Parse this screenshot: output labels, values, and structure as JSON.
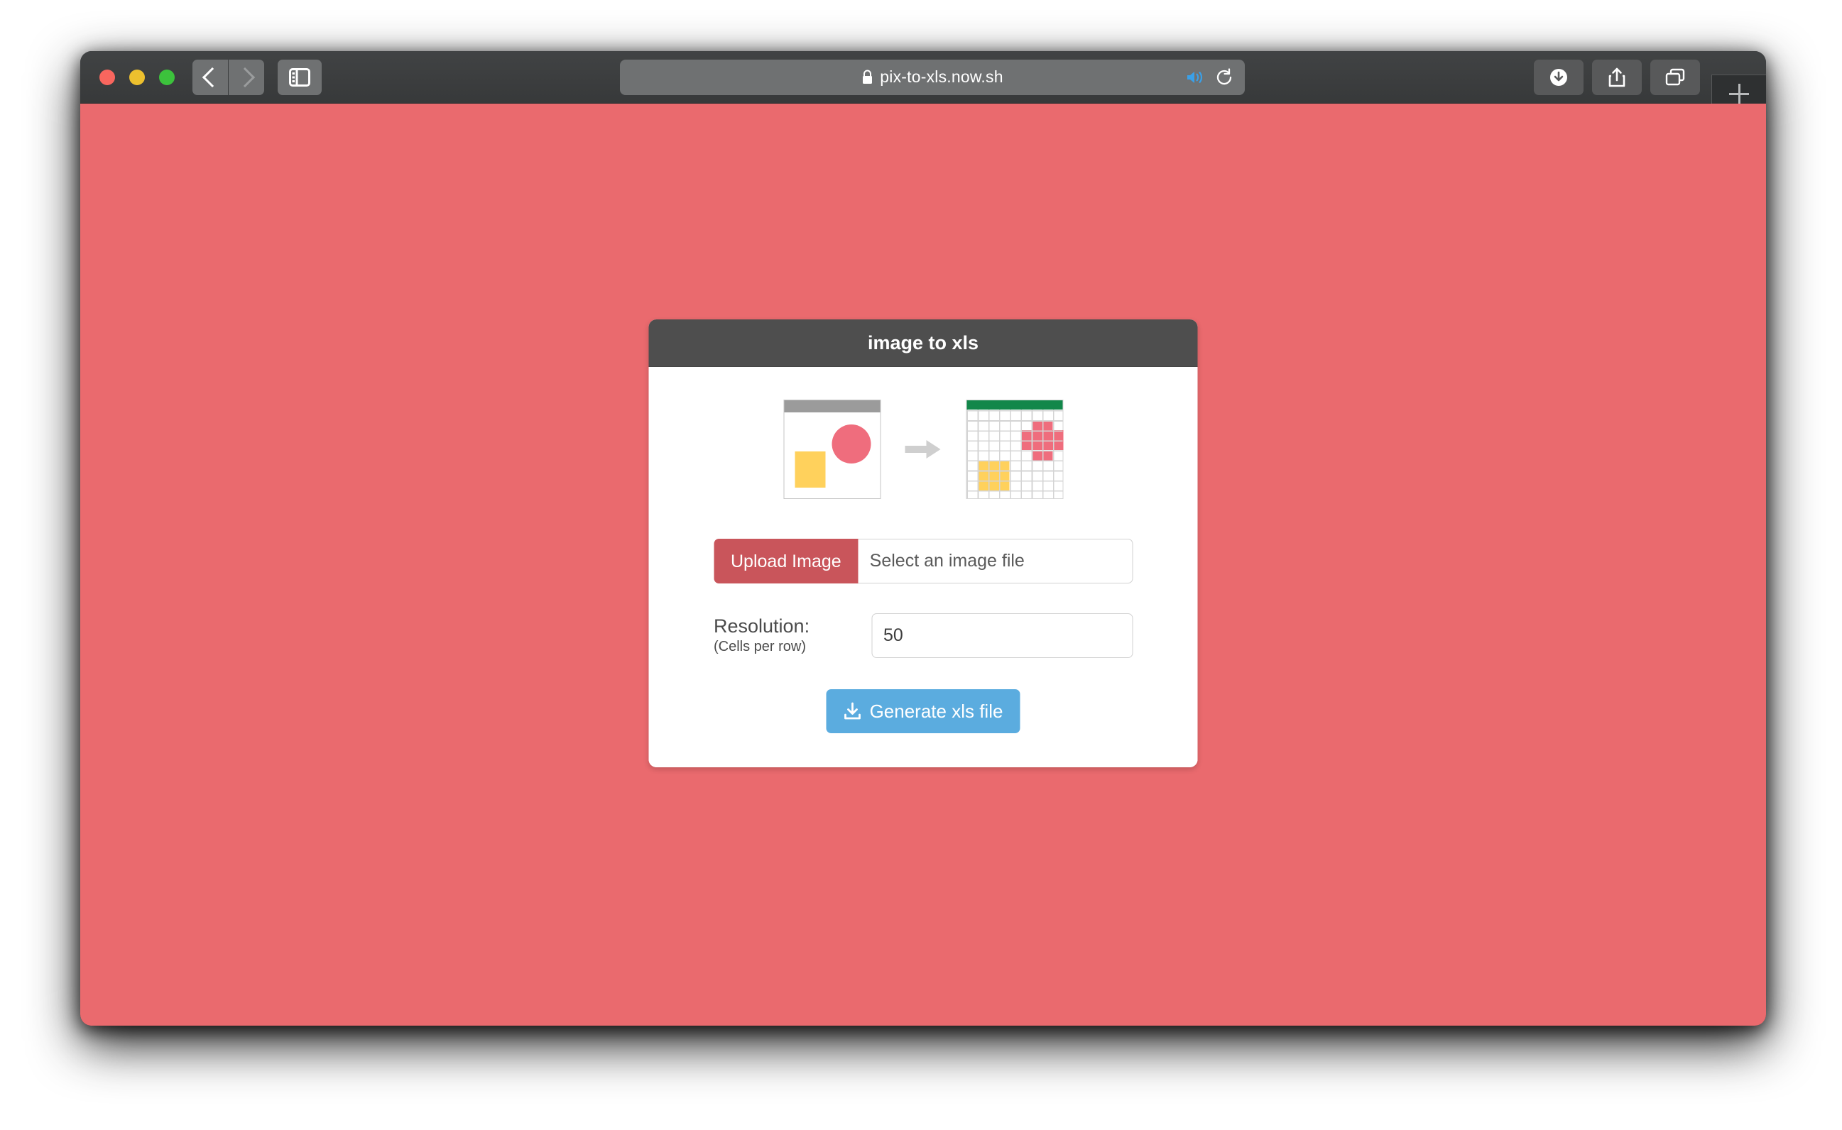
{
  "browser": {
    "url": "pix-to-xls.now.sh",
    "lock_icon": "lock-icon",
    "audio_icon": "speaker-icon",
    "reload_icon": "reload-icon",
    "back_icon": "chevron-left-icon",
    "forward_icon": "chevron-right-icon",
    "sidebar_icon": "sidebar-toggle-icon",
    "downloads_icon": "downloads-icon",
    "share_icon": "share-icon",
    "tabs_icon": "tab-overview-icon",
    "new_tab_icon": "plus-icon",
    "traffic_lights": [
      "close-button",
      "minimize-button",
      "zoom-button"
    ]
  },
  "page": {
    "background_color": "#ea6a6e",
    "card": {
      "title": "image to xls",
      "header_color": "#4e4e4e",
      "illustration": {
        "source_label": "source-image-preview",
        "arrow_label": "conversion-arrow",
        "result_label": "spreadsheet-grid-preview",
        "shape_pink": "#ef6d7d",
        "shape_yellow": "#ffd15c",
        "grid_header_color": "#12874a",
        "grid_columns": 9,
        "grid_rows": 10,
        "pink_cells": [
          [
            2,
            6
          ],
          [
            2,
            7
          ],
          [
            3,
            5
          ],
          [
            3,
            6
          ],
          [
            3,
            7
          ],
          [
            3,
            8
          ],
          [
            4,
            5
          ],
          [
            4,
            6
          ],
          [
            4,
            7
          ],
          [
            4,
            8
          ],
          [
            5,
            6
          ],
          [
            5,
            7
          ]
        ],
        "yellow_cells": [
          [
            6,
            1
          ],
          [
            6,
            2
          ],
          [
            6,
            3
          ],
          [
            7,
            1
          ],
          [
            7,
            2
          ],
          [
            7,
            3
          ],
          [
            8,
            1
          ],
          [
            8,
            2
          ],
          [
            8,
            3
          ]
        ]
      },
      "upload": {
        "button_label": "Upload Image",
        "button_color": "#c9555b",
        "file_name_value": "Select an image file"
      },
      "resolution": {
        "label": "Resolution:",
        "sublabel": "(Cells per row)",
        "value": "50"
      },
      "generate": {
        "label": "Generate xls file",
        "button_color": "#5bacdf",
        "icon": "download-icon"
      }
    }
  }
}
